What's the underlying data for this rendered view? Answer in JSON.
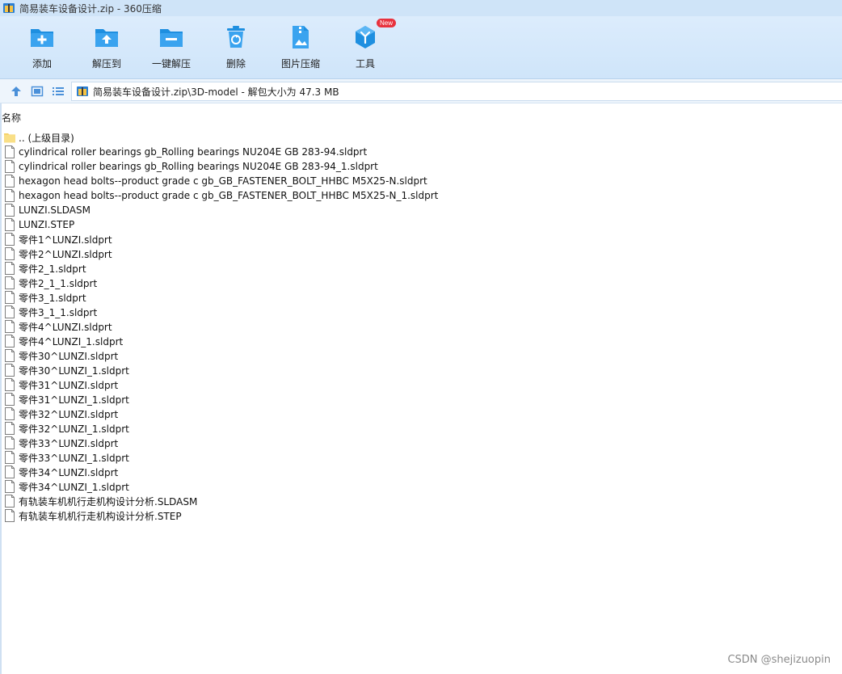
{
  "window": {
    "title": "简易装车设备设计.zip - 360压缩"
  },
  "toolbar": {
    "buttons": [
      {
        "label": "添加",
        "icon": "add-icon"
      },
      {
        "label": "解压到",
        "icon": "extract-to-icon"
      },
      {
        "label": "一键解压",
        "icon": "one-click-extract-icon"
      },
      {
        "label": "删除",
        "icon": "delete-icon"
      },
      {
        "label": "图片压缩",
        "icon": "image-compress-icon"
      },
      {
        "label": "工具",
        "icon": "tools-icon",
        "badge": "New"
      }
    ]
  },
  "navbar": {
    "path": "简易装车设备设计.zip\\3D-model - 解包大小为 47.3 MB"
  },
  "filelist": {
    "column_name": "名称",
    "items": [
      {
        "name": ".. (上级目录)",
        "type": "folder"
      },
      {
        "name": "cylindrical roller bearings gb_Rolling bearings NU204E GB 283-94.sldprt",
        "type": "file"
      },
      {
        "name": "cylindrical roller bearings gb_Rolling bearings NU204E GB 283-94_1.sldprt",
        "type": "file"
      },
      {
        "name": "hexagon head bolts--product grade c gb_GB_FASTENER_BOLT_HHBC M5X25-N.sldprt",
        "type": "file"
      },
      {
        "name": "hexagon head bolts--product grade c gb_GB_FASTENER_BOLT_HHBC M5X25-N_1.sldprt",
        "type": "file"
      },
      {
        "name": "LUNZI.SLDASM",
        "type": "file"
      },
      {
        "name": "LUNZI.STEP",
        "type": "file"
      },
      {
        "name": "零件1^LUNZI.sldprt",
        "type": "file"
      },
      {
        "name": "零件2^LUNZI.sldprt",
        "type": "file"
      },
      {
        "name": "零件2_1.sldprt",
        "type": "file"
      },
      {
        "name": "零件2_1_1.sldprt",
        "type": "file"
      },
      {
        "name": "零件3_1.sldprt",
        "type": "file"
      },
      {
        "name": "零件3_1_1.sldprt",
        "type": "file"
      },
      {
        "name": "零件4^LUNZI.sldprt",
        "type": "file"
      },
      {
        "name": "零件4^LUNZI_1.sldprt",
        "type": "file"
      },
      {
        "name": "零件30^LUNZI.sldprt",
        "type": "file"
      },
      {
        "name": "零件30^LUNZI_1.sldprt",
        "type": "file"
      },
      {
        "name": "零件31^LUNZI.sldprt",
        "type": "file"
      },
      {
        "name": "零件31^LUNZI_1.sldprt",
        "type": "file"
      },
      {
        "name": "零件32^LUNZI.sldprt",
        "type": "file"
      },
      {
        "name": "零件32^LUNZI_1.sldprt",
        "type": "file"
      },
      {
        "name": "零件33^LUNZI.sldprt",
        "type": "file"
      },
      {
        "name": "零件33^LUNZI_1.sldprt",
        "type": "file"
      },
      {
        "name": "零件34^LUNZI.sldprt",
        "type": "file"
      },
      {
        "name": "零件34^LUNZI_1.sldprt",
        "type": "file"
      },
      {
        "name": "有轨装车机机行走机构设计分析.SLDASM",
        "type": "file"
      },
      {
        "name": "有轨装车机机行走机构设计分析.STEP",
        "type": "file"
      }
    ]
  },
  "watermark": "CSDN @shejizuopin",
  "colors": {
    "accent_blue": "#1e8fe0",
    "toolbar_bg": "#d6e9fb",
    "folder_yellow": "#f6d36b"
  }
}
